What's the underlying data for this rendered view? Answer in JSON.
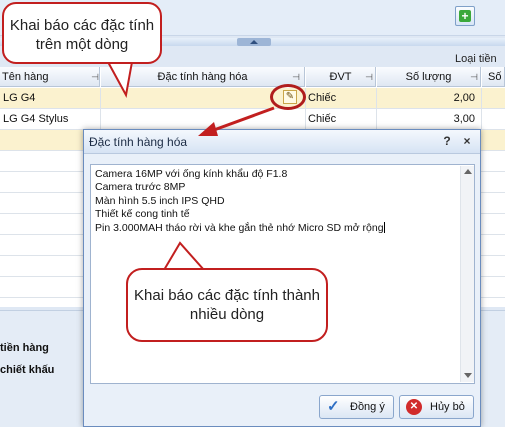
{
  "background": {
    "loai_tien_label": "Loại tiền",
    "add_icon": "plus-icon",
    "grid": {
      "columns": [
        "Tên hàng",
        "Đặc tính hàng hóa",
        "ĐVT",
        "Số lượng",
        "Số l"
      ],
      "rows": [
        {
          "ten_hang": "LG G4",
          "dac_tinh": "",
          "dvt": "Chiếc",
          "so_luong": "2,00"
        },
        {
          "ten_hang": "LG G4 Stylus",
          "dac_tinh": "",
          "dvt": "Chiếc",
          "so_luong": "3,00"
        }
      ]
    },
    "footer": {
      "label_1": "tiền hàng",
      "label_2": "chiết khấu"
    }
  },
  "callouts": {
    "single_line": "Khai báo các đặc tính trên một dòng",
    "multi_line": "Khai báo các đặc tính thành nhiều dòng"
  },
  "dialog": {
    "title": "Đặc tính hàng hóa",
    "help_label": "?",
    "close_label": "×",
    "text_lines": [
      "Camera 16MP với ống kính khẩu độ F1.8",
      "Camera trước 8MP",
      "Màn hình 5.5 inch IPS QHD",
      "Thiết kế cong tinh tế",
      "Pin 3.000MAH tháo rời và khe gắn thẻ nhớ Micro SD mở rộng"
    ],
    "ok_label": "Đồng ý",
    "cancel_label": "Hủy bỏ"
  },
  "colors": {
    "selected_row": "#fbf2cf",
    "callout_border": "#c21f1f",
    "dialog_bg": "#e9f0f9"
  }
}
